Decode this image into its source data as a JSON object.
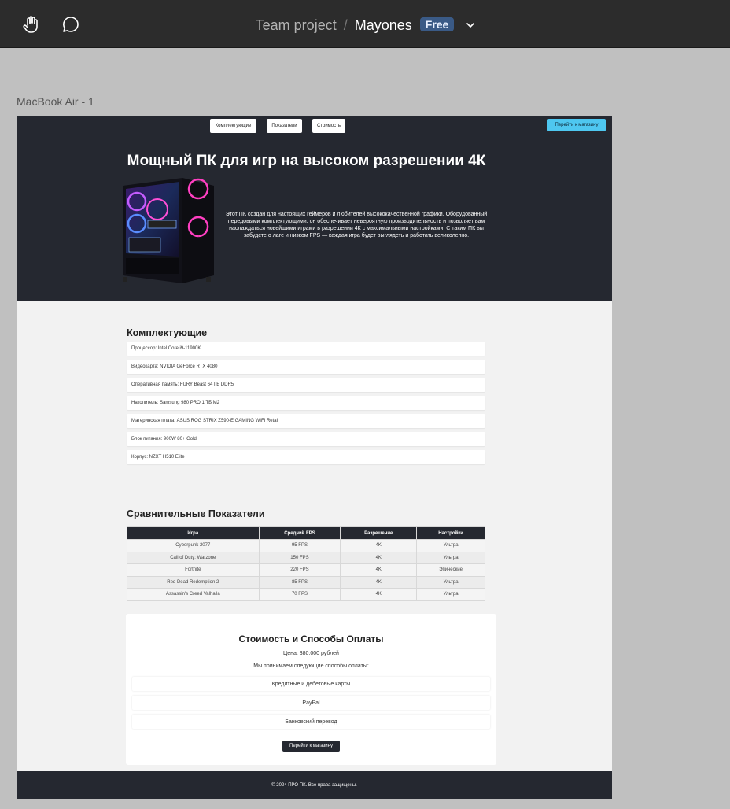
{
  "toolbar": {
    "hand_icon": "hand-tool-icon",
    "comment_icon": "comment-icon",
    "team": "Team project",
    "separator": "/",
    "file": "Mayones",
    "badge": "Free",
    "menu_icon": "chevron-down-icon"
  },
  "frame_label": "MacBook Air - 1",
  "hero": {
    "nav": [
      "Комплектующие",
      "Показатели",
      "Стоимость"
    ],
    "shop_button": "Перейти к магазину",
    "title": "Мощный ПК для игр на высоком разрешении 4К",
    "text": "Этот ПК создан для настоящих геймеров и любителей высококачественной графики. Оборудованный передовыми комплектующими, он обеспечивает невероятную производительность и позволяет вам наслаждаться новейшими играми в разрешении 4К с максимальными настройками. С таким ПК вы забудете о лаге и низком FPS — каждая игра будет выглядеть и работать великолепно."
  },
  "components": {
    "title": "Комплектующие",
    "items": [
      "Процессор: Intel Core i9-11900K",
      "Видеокарта: NVIDIA GeForce RTX 4080",
      "Оперативная память: FURY Beast 64 ГБ DDR5",
      "Накопитель: Samsung 980 PRO 1 ТБ M2",
      "Материнская плата: ASUS ROG STRIX Z590-E GAMING WIFI Retail",
      "Блок питания: 900W 80+ Gold",
      "Корпус: NZXT H510 Elite"
    ]
  },
  "stats": {
    "title": "Сравнительные Показатели",
    "headers": [
      "Игра",
      "Средний FPS",
      "Разрешение",
      "Настройки"
    ],
    "rows": [
      [
        "Cyberpunk 2077",
        "95 FPS",
        "4K",
        "Ультра"
      ],
      [
        "Call of Duty: Warzone",
        "150 FPS",
        "4K",
        "Ультра"
      ],
      [
        "Fortnite",
        "220 FPS",
        "4K",
        "Эпические"
      ],
      [
        "Red Dead Redemption 2",
        "85 FPS",
        "4K",
        "Ультра"
      ],
      [
        "Assassin's Creed Valhalla",
        "70 FPS",
        "4K",
        "Ультра"
      ]
    ]
  },
  "pricing": {
    "title": "Стоимость и Способы Оплаты",
    "price": "Цена: 380.000 рублей",
    "methods_intro": "Мы принимаем следующие способы оплаты:",
    "methods": [
      "Кредитные и дебетовые карты",
      "PayPal",
      "Банковский перевод"
    ],
    "button": "Перейти к магазину"
  },
  "footer": "© 2024 ПРО ПК. Все права защищены."
}
